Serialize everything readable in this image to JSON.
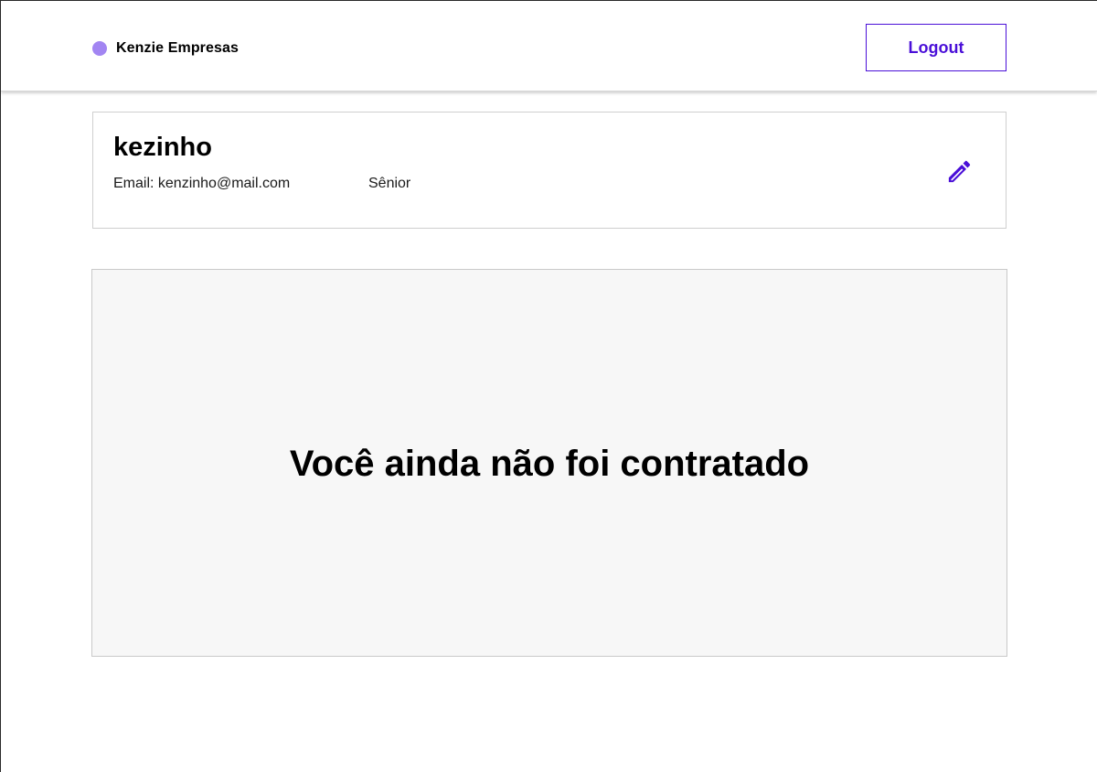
{
  "header": {
    "brand_name": "Kenzie Empresas",
    "logout_label": "Logout"
  },
  "profile": {
    "name": "kezinho",
    "email_label": "Email: kenzinho@mail.com",
    "level": "Sênior",
    "edit_icon": "pencil-icon"
  },
  "status": {
    "message": "Você ainda não foi contratado"
  },
  "colors": {
    "accent": "#4a0fd8",
    "brand_dot": "#a285f2",
    "panel_background": "#f7f7f7",
    "border": "#cfcfcf"
  }
}
